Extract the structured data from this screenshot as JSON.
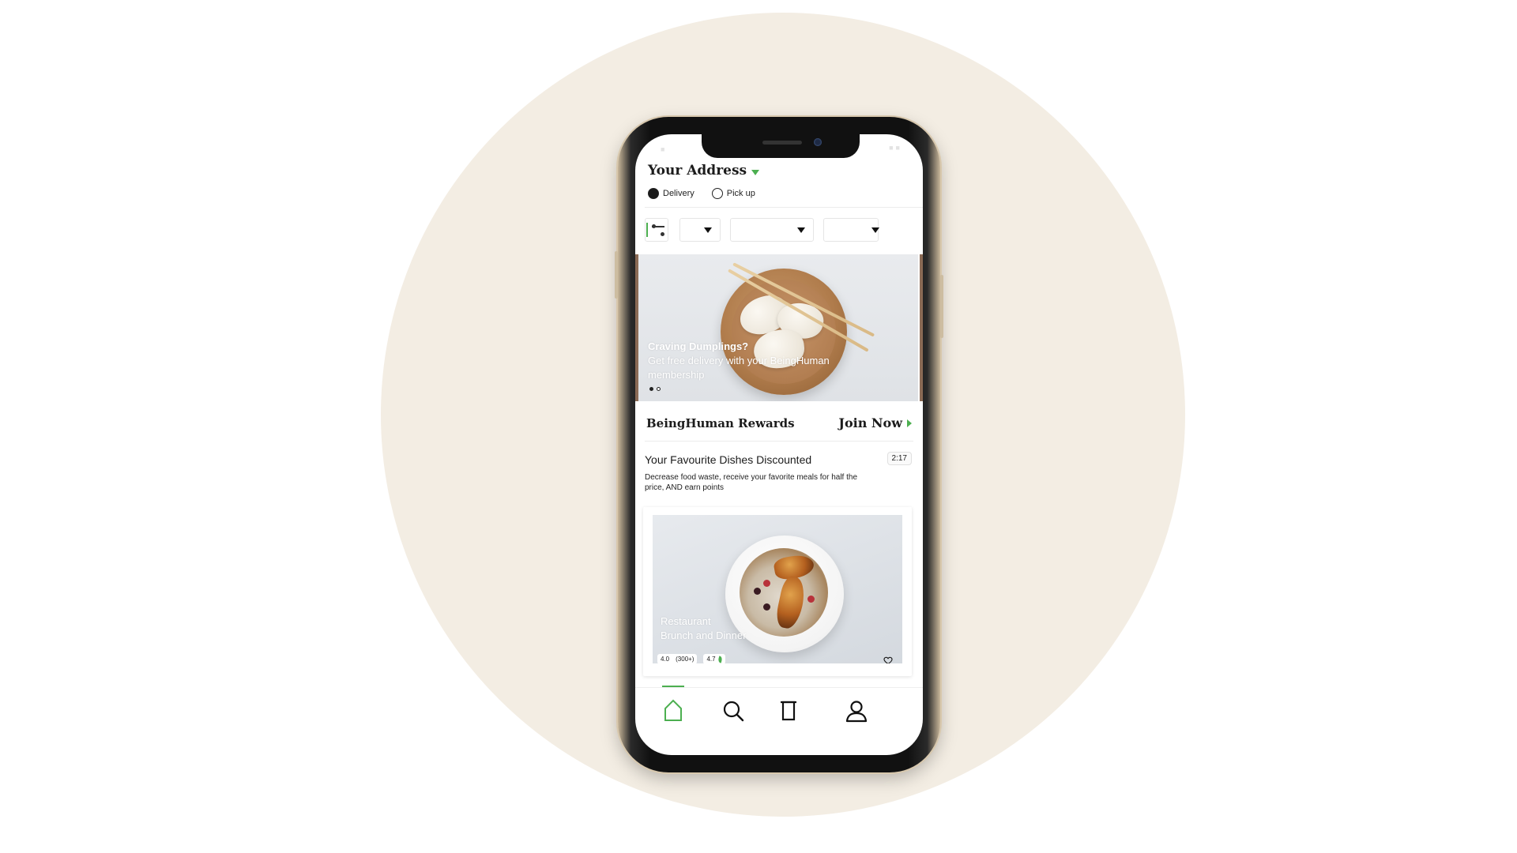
{
  "header": {
    "address_title": "Your Address",
    "delivery_label": "Delivery",
    "pickup_label": "Pick up",
    "selected_mode": "Delivery"
  },
  "banner": {
    "headline": "Craving Dumplings?",
    "line2": "Get free delivery with your  BeingHuman",
    "line3": "membership",
    "slide_count": 2,
    "active_slide": 1
  },
  "rewards": {
    "title": "BeingHuman Rewards",
    "cta": "Join Now"
  },
  "discounts": {
    "title": "Your Favourite Dishes Discounted",
    "timer": "2:17",
    "description": "Decrease food waste, receive your favorite meals for half the price, AND earn points"
  },
  "dish_card": {
    "name": "Restaurant",
    "category": "Brunch and Dinner",
    "rating": "4.0",
    "reviews": "(300+)",
    "eco_rating": "4.7"
  },
  "tabs": [
    {
      "name": "home",
      "icon": "home-icon",
      "active": true
    },
    {
      "name": "search",
      "icon": "search-icon",
      "active": false
    },
    {
      "name": "orders",
      "icon": "bag-icon",
      "active": false
    },
    {
      "name": "profile",
      "icon": "user-icon",
      "active": false
    }
  ],
  "colors": {
    "accent": "#4caf50",
    "background_circle": "#f3ede3",
    "text": "#1c1c1c"
  }
}
